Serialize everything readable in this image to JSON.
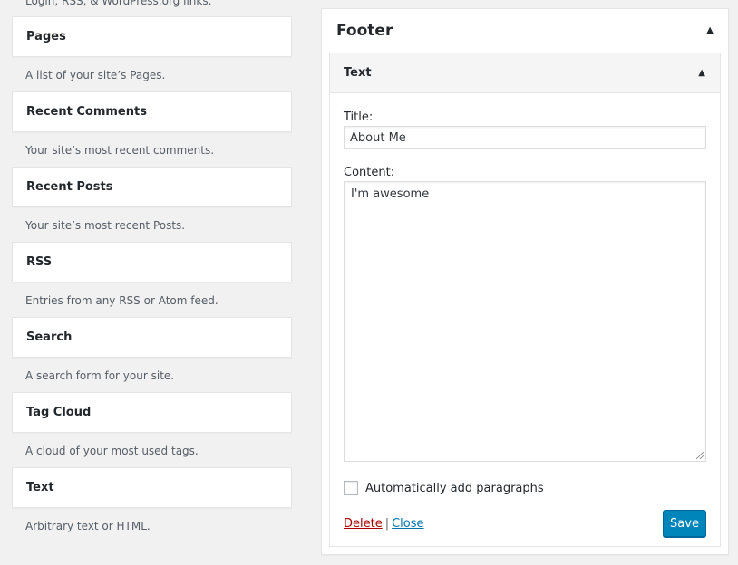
{
  "available_widgets": {
    "top_partial_description": "Login, RSS, & WordPress.org links.",
    "items": [
      {
        "title": "Pages",
        "description": "A list of your site’s Pages."
      },
      {
        "title": "Recent Comments",
        "description": "Your site’s most recent comments."
      },
      {
        "title": "Recent Posts",
        "description": "Your site’s most recent Posts."
      },
      {
        "title": "RSS",
        "description": "Entries from any RSS or Atom feed."
      },
      {
        "title": "Search",
        "description": "A search form for your site."
      },
      {
        "title": "Tag Cloud",
        "description": "A cloud of your most used tags."
      },
      {
        "title": "Text",
        "description": "Arbitrary text or HTML."
      }
    ]
  },
  "sidebar": {
    "title": "Footer",
    "widget": {
      "title": "Text",
      "title_label": "Title:",
      "title_value": "About Me",
      "content_label": "Content:",
      "content_value": "I'm awesome",
      "auto_paragraphs_label": "Automatically add paragraphs",
      "delete_label": "Delete",
      "separator": "|",
      "close_label": "Close",
      "save_label": "Save"
    }
  },
  "colors": {
    "primary_button": "#0085ba",
    "delete_link": "#a00000",
    "close_link": "#0073aa"
  },
  "icons": {
    "collapse": "caret-up-icon"
  }
}
